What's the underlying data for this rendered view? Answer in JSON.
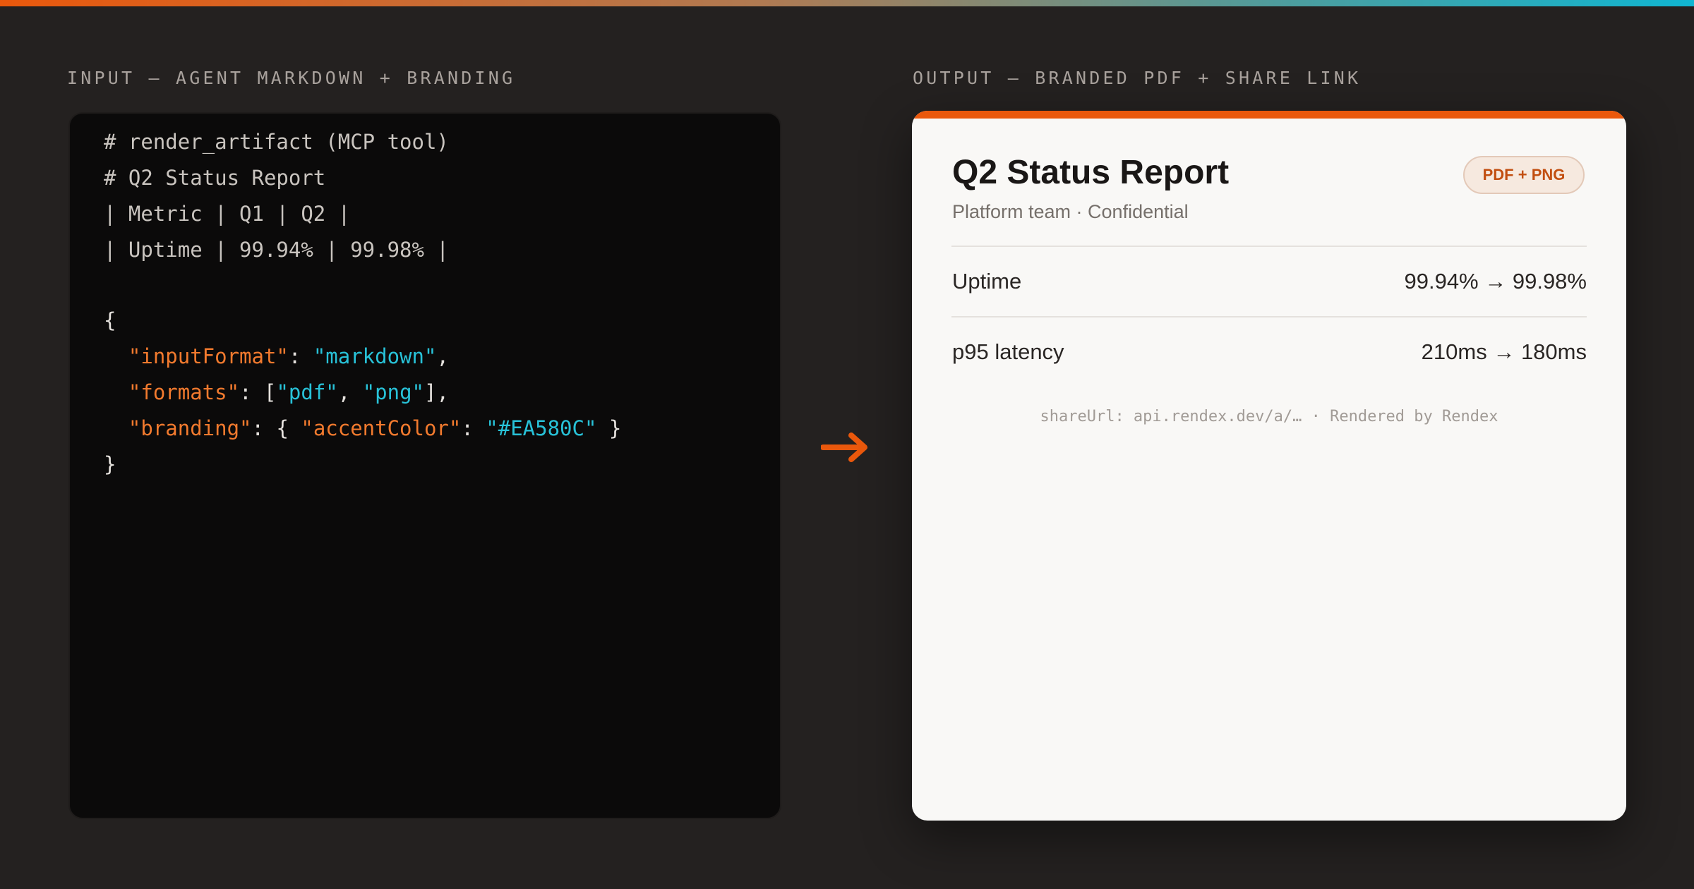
{
  "labels": {
    "input": "INPUT — AGENT MARKDOWN + BRANDING",
    "output": "OUTPUT — BRANDED PDF + SHARE LINK"
  },
  "code": {
    "line1": "# render_artifact (MCP tool)",
    "line2": "# Q2 Status Report",
    "line3": "| Metric | Q1 | Q2 |",
    "line4": "| Uptime | 99.94% | 99.98% |",
    "brace_open": "{",
    "key_input_format": "\"inputFormat\"",
    "val_input_format": "\"markdown\"",
    "key_formats": "\"formats\"",
    "val_format_pdf": "\"pdf\"",
    "val_format_png": "\"png\"",
    "key_branding": "\"branding\"",
    "key_accent_color": "\"accentColor\"",
    "val_accent_color": "\"#EA580C\"",
    "brace_close": "}"
  },
  "document": {
    "title": "Q2 Status Report",
    "subtitle": "Platform team · Confidential",
    "badge": "PDF + PNG",
    "rows": [
      {
        "label": "Uptime",
        "value": "99.94% → 99.98%"
      },
      {
        "label": "p95 latency",
        "value": "210ms → 180ms"
      }
    ],
    "footer": "shareUrl: api.rendex.dev/a/… · Rendered by Rendex"
  },
  "colors": {
    "accent": "#EA580C",
    "background": "#242120",
    "code_background": "#0B0A0A",
    "json_key": "#F27A2E",
    "json_string": "#28C2D8",
    "document_background": "#F9F8F6"
  },
  "icons": {
    "arrow": "arrow-right-icon"
  }
}
